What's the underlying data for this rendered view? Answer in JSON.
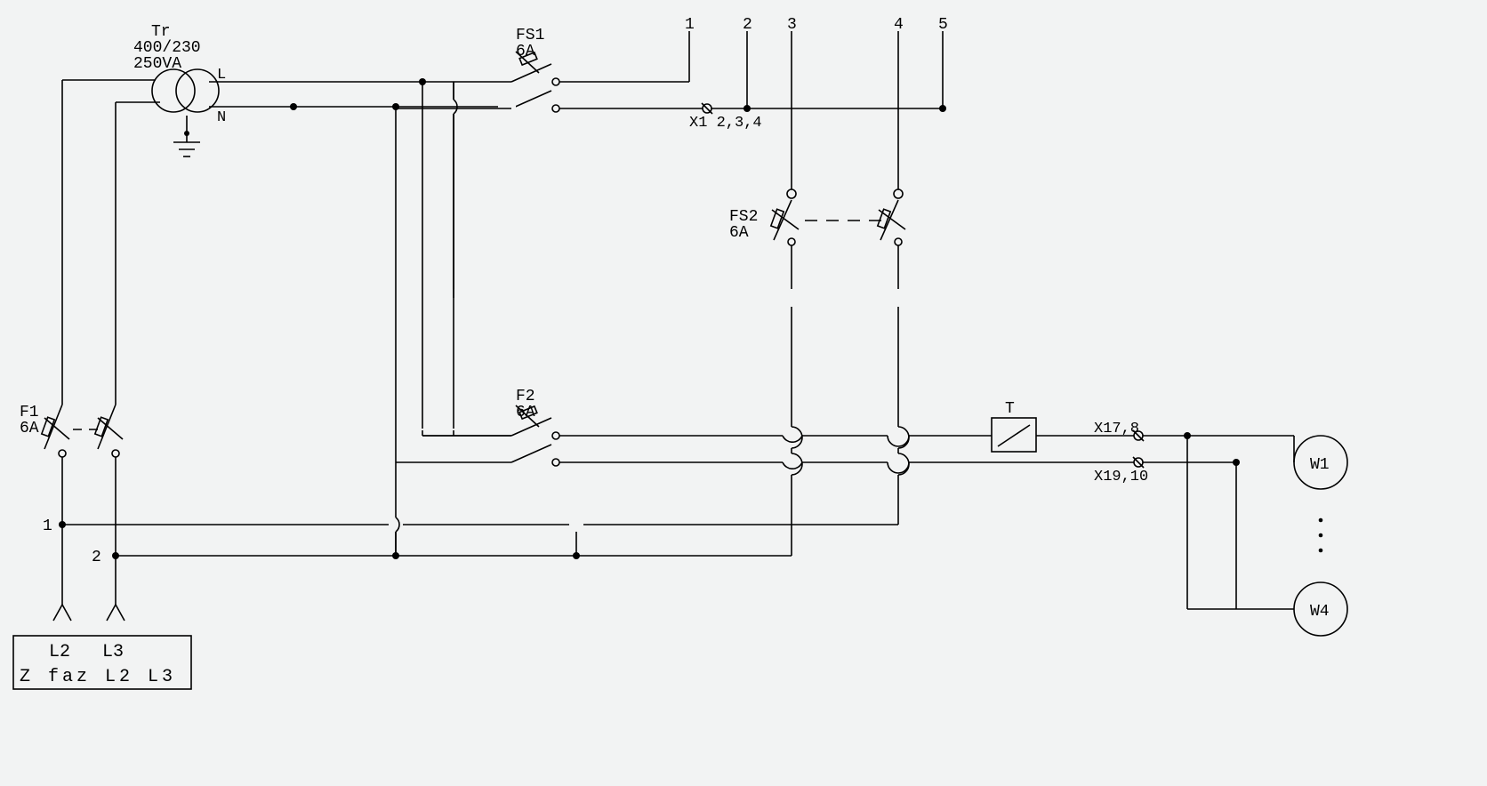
{
  "transformer": {
    "name": "Tr",
    "rating1": "400/230",
    "rating2": "250VA",
    "terminal_L": "L",
    "terminal_N": "N"
  },
  "fuses": {
    "F1": {
      "name": "F1",
      "rating": "6A"
    },
    "FS1": {
      "name": "FS1",
      "rating": "6A"
    },
    "FS2": {
      "name": "FS2",
      "rating": "6A"
    },
    "F2": {
      "name": "F2",
      "rating": "6A"
    }
  },
  "top_numbers": [
    "1",
    "2",
    "3",
    "4",
    "5"
  ],
  "terminals": {
    "X1": "X1 2,3,4",
    "X17": "X17,8",
    "X19": "X19,10"
  },
  "thermostat": "T",
  "fans": {
    "W1": "W1",
    "W4": "W4"
  },
  "line_numbers": {
    "n1": "1",
    "n2": "2"
  },
  "phase_box": {
    "l2": "L2",
    "l3": "L3",
    "text": "Z  faz L2 L3"
  }
}
